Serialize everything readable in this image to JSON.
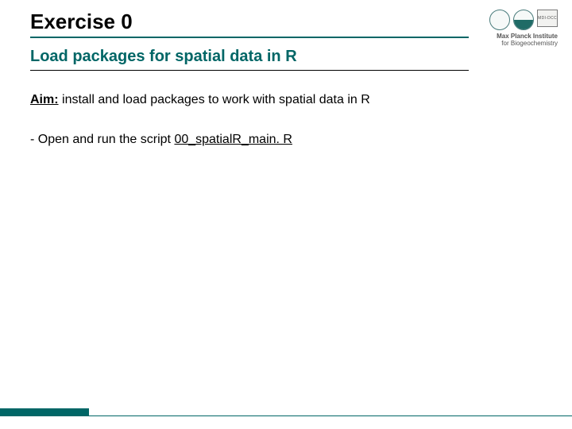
{
  "header": {
    "title": "Exercise 0",
    "institute_line1": "Max Planck Institute",
    "institute_line2": "for Biogeochemistry",
    "badge_text": "MDI-DCC"
  },
  "subheading": "Load packages for spatial data in R",
  "aim": {
    "label": "Aim:",
    "text": " install and load packages to work with spatial data in R"
  },
  "body": {
    "prefix": "- Open and run the script ",
    "script_name": "00_spatialR_main. R"
  }
}
